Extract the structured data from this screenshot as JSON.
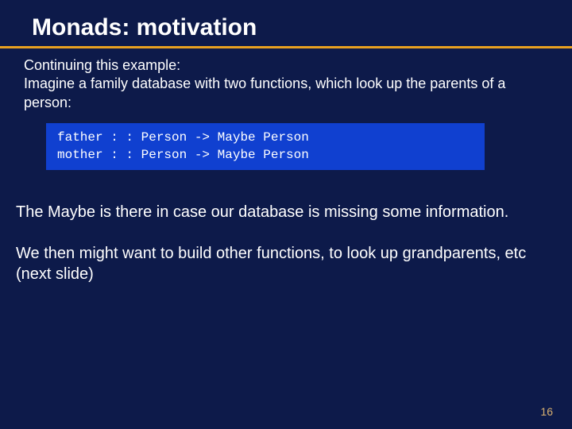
{
  "title": "Monads: motivation",
  "intro": "Continuing this example:\nImagine a family database with two functions, which look up the parents of a person:",
  "code": "father : : Person -> Maybe Person\nmother : : Person -> Maybe Person",
  "body1": "The Maybe is there in case our database is missing some information.",
  "body2": "We then might want to build other functions, to look up grandparents, etc (next slide)",
  "page_number": "16"
}
